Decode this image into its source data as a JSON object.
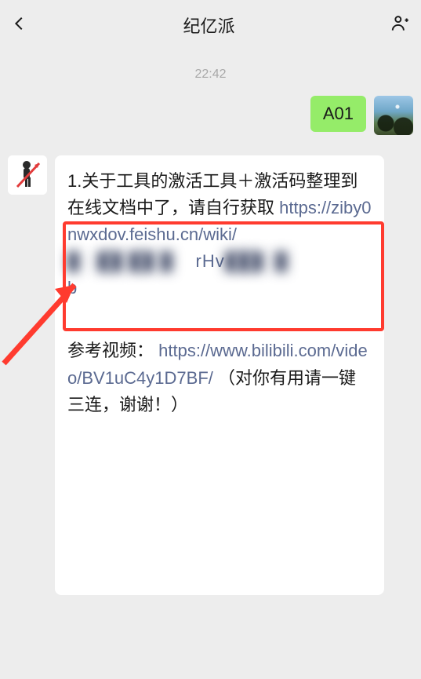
{
  "header": {
    "title": "纪亿派"
  },
  "timestamp": "22:42",
  "outgoing": {
    "text": "A01"
  },
  "incoming": {
    "line1": "1.关于工具的激活工具＋激活码整理到在线文档中了，请自行获取",
    "link1": "https://ziby0nwxdov.feishu.cn/wiki/",
    "blurred_visible": "rHv",
    "blurred_tail": "b",
    "para2_prefix": "参考视频：",
    "link2": "https://www.bilibili.com/video/BV1uC4y1D7BF/",
    "para2_suffix": "（对你有用请一键三连，谢谢！）"
  }
}
